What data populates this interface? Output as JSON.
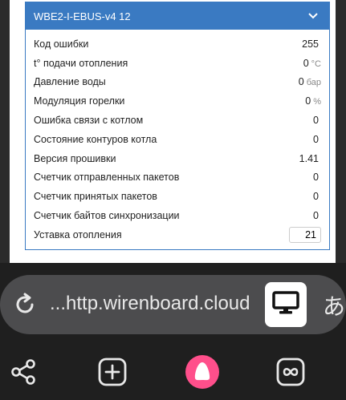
{
  "panel": {
    "title": "WBE2-I-EBUS-v4 12",
    "rows": [
      {
        "label": "Код ошибки",
        "value": "255",
        "unit": ""
      },
      {
        "label": "t° подачи отопления",
        "value": "0",
        "unit": "°C"
      },
      {
        "label": "Давление воды",
        "value": "0",
        "unit": "бар"
      },
      {
        "label": "Модуляция горелки",
        "value": "0",
        "unit": "%"
      },
      {
        "label": "Ошибка связи с котлом",
        "value": "0",
        "unit": ""
      },
      {
        "label": "Состояние контуров котла",
        "value": "0",
        "unit": ""
      },
      {
        "label": "Версия прошивки",
        "value": "1.41",
        "unit": ""
      },
      {
        "label": "Счетчик отправленных пакетов",
        "value": "0",
        "unit": ""
      },
      {
        "label": "Счетчик принятых пакетов",
        "value": "0",
        "unit": ""
      },
      {
        "label": "Счетчик байтов синхронизации",
        "value": "0",
        "unit": ""
      }
    ],
    "setpoint": {
      "label": "Уставка отопления",
      "value": "21"
    }
  },
  "browser": {
    "url": "...http.wirenboard.cloud",
    "translate_glyph": "あ"
  },
  "colors": {
    "accent": "#3a7ac2",
    "alice": "#ff4f8b",
    "chrome": "#1f1f1f"
  },
  "icons": [
    "chevron-down-icon",
    "reload-icon",
    "desktop-icon",
    "share-icon",
    "new-tab-icon",
    "alice-icon",
    "tabs-icon"
  ]
}
